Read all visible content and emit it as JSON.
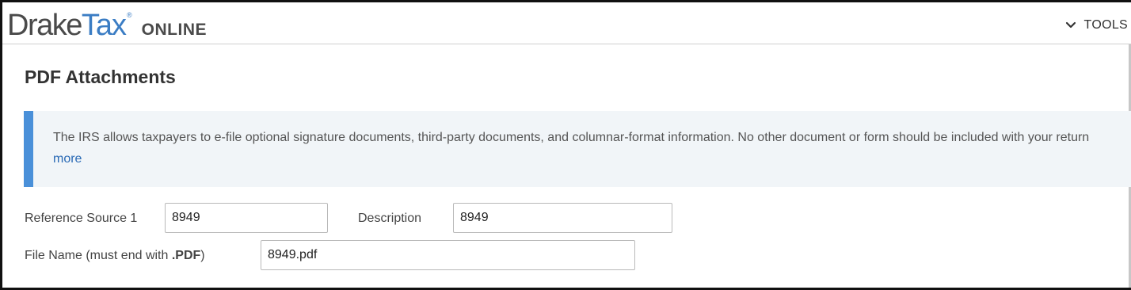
{
  "header": {
    "logo": {
      "drake": "Drake",
      "tax": "Tax",
      "reg": "®",
      "online": "ONLINE"
    },
    "tools_label": "TOOLS"
  },
  "page": {
    "title": "PDF Attachments"
  },
  "info": {
    "text": "The IRS allows taxpayers to e-file optional signature documents, third-party documents, and columnar-format information. No other document or form should be included with your return",
    "more_link": "more"
  },
  "form": {
    "reference_source": {
      "label": "Reference Source 1",
      "value": "8949"
    },
    "description": {
      "label": "Description",
      "value": "8949"
    },
    "file_name": {
      "label_prefix": "File Name (must end with ",
      "label_bold": ".PDF",
      "label_suffix": ")",
      "value": "8949.pdf"
    }
  },
  "colors": {
    "accent": "#4a90d9",
    "link": "#2a6ab5",
    "logo_blue": "#3b7dc4",
    "info_bg": "#f1f5f8"
  }
}
